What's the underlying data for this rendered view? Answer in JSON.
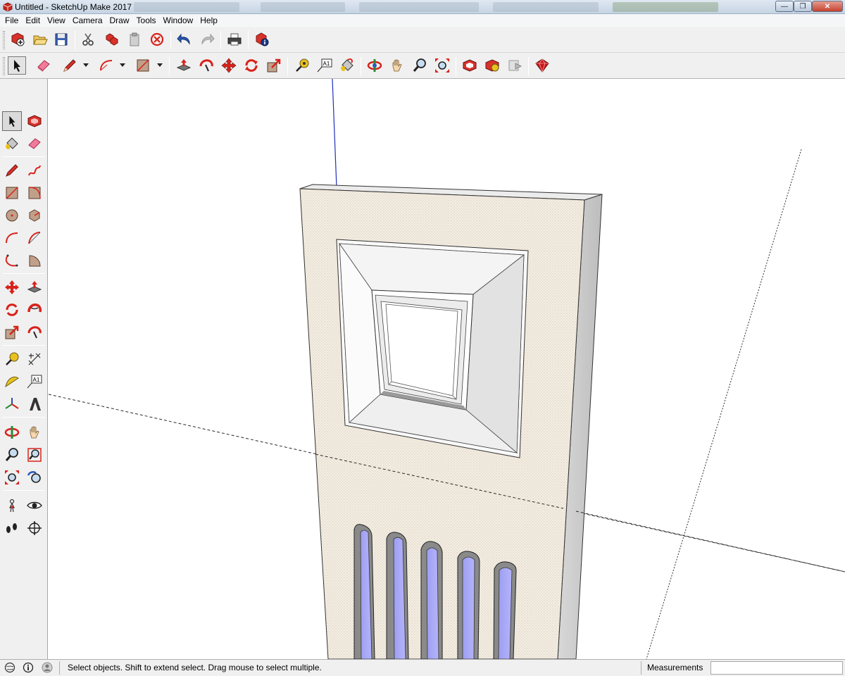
{
  "window": {
    "title": "Untitled - SketchUp Make 2017",
    "minimize": "0",
    "maximize": "1",
    "close": "r"
  },
  "menu": [
    "File",
    "Edit",
    "View",
    "Camera",
    "Draw",
    "Tools",
    "Window",
    "Help"
  ],
  "toolbar_getting_started": [
    "new-model-icon",
    "open-icon",
    "save-icon",
    "cut-icon",
    "copy-icon",
    "paste-icon",
    "erase-selection-icon",
    "undo-icon",
    "redo-icon",
    "print-icon",
    "model-info-icon"
  ],
  "toolbar_principal": [
    "select-icon",
    "eraser-icon",
    "pencil-icon",
    "arc-icon",
    "rectangle-icon",
    "push-pull-icon",
    "follow-me-icon",
    "move-icon",
    "rotate-icon",
    "scale-icon",
    "tape-measure-icon",
    "text-icon",
    "paint-bucket-icon",
    "orbit-icon",
    "pan-icon",
    "zoom-icon",
    "zoom-extents-icon",
    "3d-warehouse-icon",
    "extension-warehouse-icon",
    "layout-icon",
    "extension-manager-icon"
  ],
  "palette": [
    "select-icon",
    "make-component-icon",
    "paint-bucket-icon",
    "eraser-icon",
    "line-icon",
    "freehand-icon",
    "rectangle-icon",
    "rotated-rectangle-icon",
    "circle-icon",
    "polygon-icon",
    "arc-icon",
    "two-point-arc-icon",
    "three-point-arc-icon",
    "pie-icon",
    "move-icon",
    "push-pull-icon",
    "rotate-icon",
    "follow-me-icon",
    "scale-icon",
    "offset-icon",
    "tape-measure-icon",
    "dimension-icon",
    "protractor-icon",
    "text-icon",
    "axes-icon",
    "3d-text-icon",
    "orbit-icon",
    "pan-icon",
    "zoom-icon",
    "zoom-window-icon",
    "zoom-extents-icon",
    "previous-view-icon",
    "position-camera-icon",
    "look-around-icon",
    "walk-icon",
    "section-plane-icon"
  ],
  "text_tool_label": "A1",
  "status": {
    "message": "Select objects. Shift to extend select. Drag mouse to select multiple.",
    "measurements_label": "Measurements",
    "measurements_value": ""
  },
  "colors": {
    "panel_face": "#f2ebe0",
    "panel_side": "#c8c8c8",
    "slot_glass": "#a4a4f4",
    "blue_axis": "#1f2fb8",
    "red_green_axes": "#2a2a2a"
  }
}
